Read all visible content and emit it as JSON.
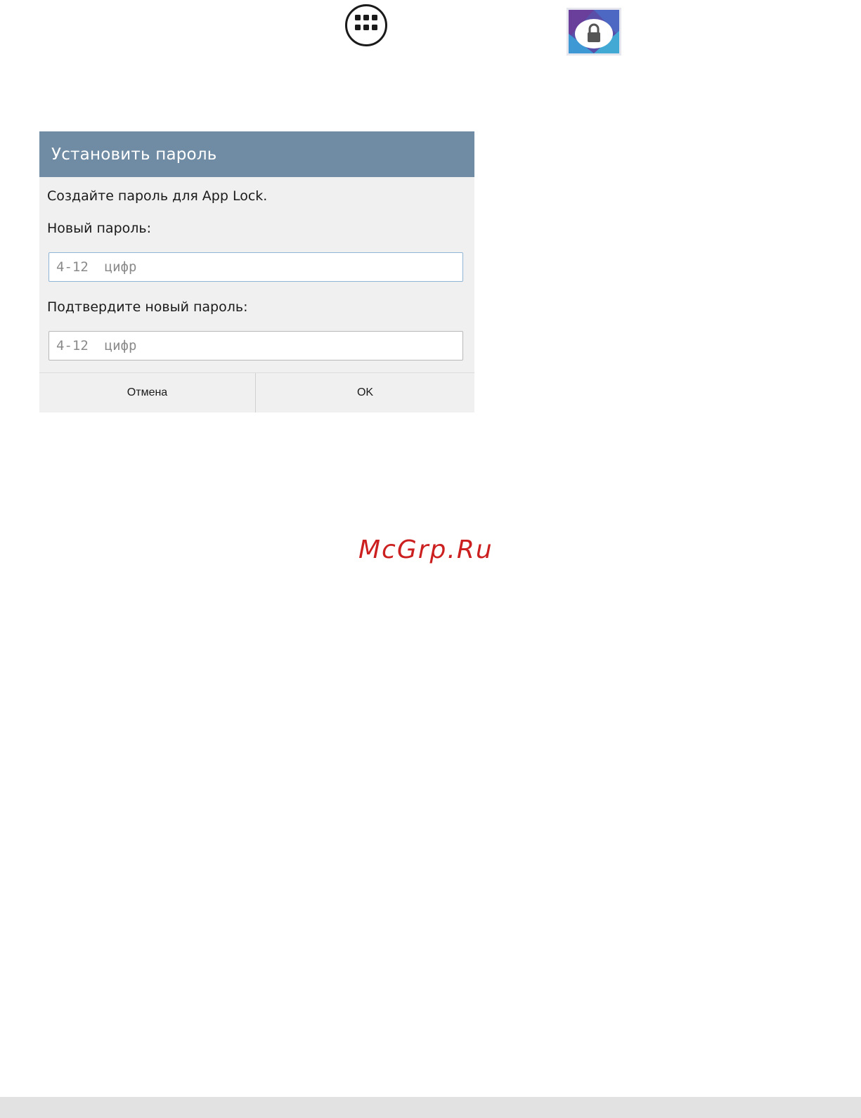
{
  "dialog": {
    "title": "Установить пароль",
    "prompt": "Создайте пароль для App Lock.",
    "new_password_label": "Новый пароль:",
    "new_password_placeholder": "4-12  цифр",
    "new_password_value": "",
    "confirm_password_label": "Подтвердите новый пароль:",
    "confirm_password_placeholder": "4-12  цифр",
    "confirm_password_value": "",
    "cancel_label": "Отмена",
    "ok_label": "OK"
  },
  "icons": {
    "apps": "apps-grid-icon",
    "applock": "app-lock-icon"
  },
  "watermark": "McGrp.Ru",
  "colors": {
    "header": "#708ca4",
    "dialog_bg": "#f0f0f0",
    "focused_field_border": "#8fb6d6",
    "watermark": "#cc1f1f"
  }
}
